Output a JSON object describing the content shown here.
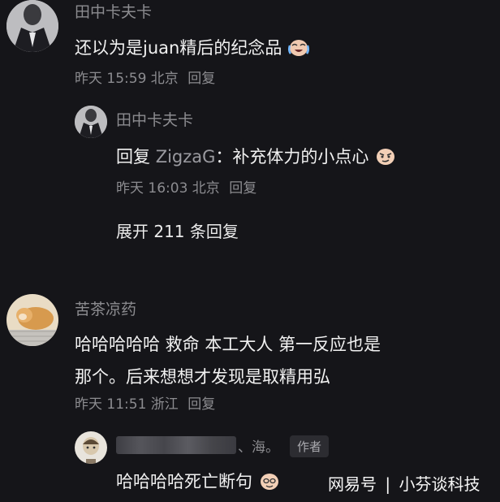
{
  "comments": [
    {
      "username": "田中卡夫卡",
      "text": "还以为是juan精后的纪念品",
      "meta": "昨天 15:59 北京",
      "reply_label": "回复",
      "emoji": "crying-laugh-emoji",
      "replies": [
        {
          "username": "田中卡夫卡",
          "reply_prefix": "回复",
          "reply_to": "ZigzaG",
          "text": "：补充体力的小点心",
          "emoji": "smirk-emoji",
          "meta": "昨天 16:03 北京",
          "reply_label": "回复"
        }
      ],
      "expand_label": "展开 211 条回复"
    },
    {
      "username": "苦茶凉药",
      "text_line1": "哈哈哈哈哈 救命 本工大人 第一反应也是",
      "text_line2": "那个。后来想想才发现是取精用弘",
      "meta": "昨天 11:51 浙江",
      "reply_label": "回复",
      "replies": [
        {
          "username_tail": "、海。",
          "author_badge": "作者",
          "text": "哈哈哈哈死亡断句",
          "emoji": "sweat-smile-emoji"
        }
      ]
    }
  ],
  "watermark": {
    "brand": "网易号",
    "separator": "|",
    "account": "小芬谈科技"
  },
  "colors": {
    "background": "#151519",
    "primary_text": "#f1f1f1",
    "secondary_text": "#8c8c90"
  }
}
